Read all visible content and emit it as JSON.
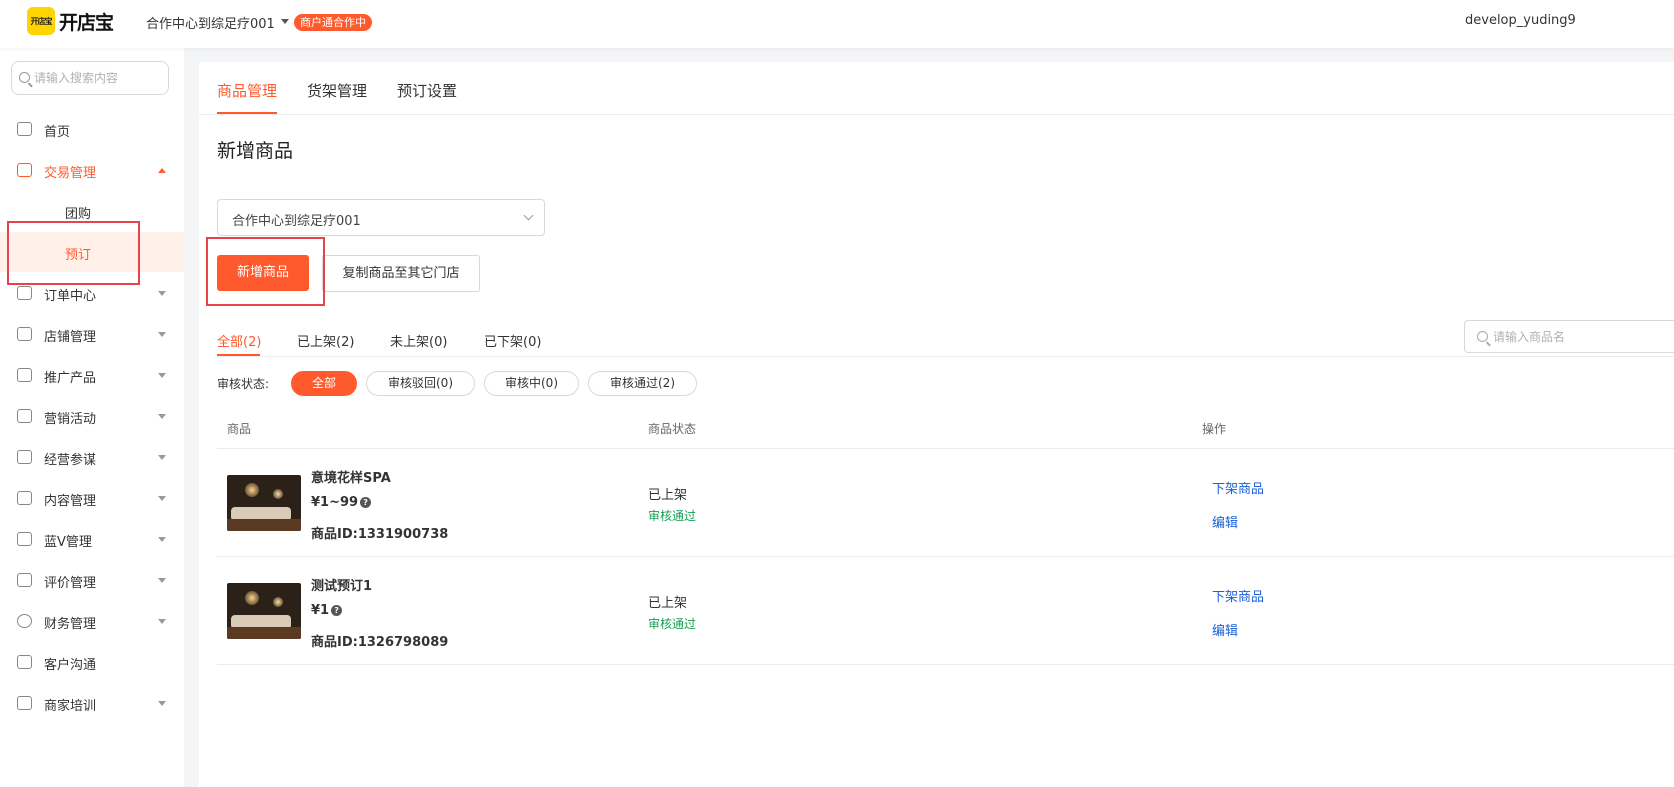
{
  "header": {
    "logo_badge": "开店宝",
    "logo_text": "开店宝",
    "store_name": "合作中心到综足疗001",
    "store_badge": "商户通合作中",
    "user_name": "develop_yuding9"
  },
  "sidebar": {
    "search_placeholder": "请输入搜索内容",
    "items": [
      {
        "label": "首页",
        "icon": "home-icon"
      },
      {
        "label": "交易管理",
        "icon": "trade-icon"
      },
      {
        "label": "团购"
      },
      {
        "label": "预订"
      },
      {
        "label": "订单中心",
        "icon": "order-icon"
      },
      {
        "label": "店铺管理",
        "icon": "store-icon"
      },
      {
        "label": "推广产品",
        "icon": "megaphone-icon"
      },
      {
        "label": "营销活动",
        "icon": "people-icon"
      },
      {
        "label": "经营参谋",
        "icon": "compass-icon"
      },
      {
        "label": "内容管理",
        "icon": "content-icon"
      },
      {
        "label": "蓝V管理",
        "icon": "apps-icon"
      },
      {
        "label": "评价管理",
        "icon": "thumb-icon"
      },
      {
        "label": "财务管理",
        "icon": "yen-icon"
      },
      {
        "label": "客户沟通",
        "icon": "chat-icon"
      },
      {
        "label": "商家培训",
        "icon": "graduation-icon"
      }
    ]
  },
  "main": {
    "tabs": [
      "商品管理",
      "货架管理",
      "预订设置"
    ],
    "page_title": "新增商品",
    "store_select_value": "合作中心到综足疗001",
    "add_button": "新增商品",
    "copy_button": "复制商品至其它门店",
    "filter_tabs": [
      "全部(2)",
      "已上架(2)",
      "未上架(0)",
      "已下架(0)"
    ],
    "name_search_placeholder": "请输入商品名",
    "audit_label": "审核状态:",
    "audit_pills": [
      "全部",
      "审核驳回(0)",
      "审核中(0)",
      "审核通过(2)"
    ],
    "columns": [
      "商品",
      "商品状态",
      "操作"
    ],
    "products": [
      {
        "name": "意境花样SPA",
        "price": "¥1~99",
        "id": "商品ID:1331900738",
        "status": "已上架",
        "audit": "审核通过",
        "op1": "下架商品",
        "op2": "编辑"
      },
      {
        "name": "测试预订1",
        "price": "¥1",
        "id": "商品ID:1326798089",
        "status": "已上架",
        "audit": "审核通过",
        "op1": "下架商品",
        "op2": "编辑"
      }
    ]
  }
}
